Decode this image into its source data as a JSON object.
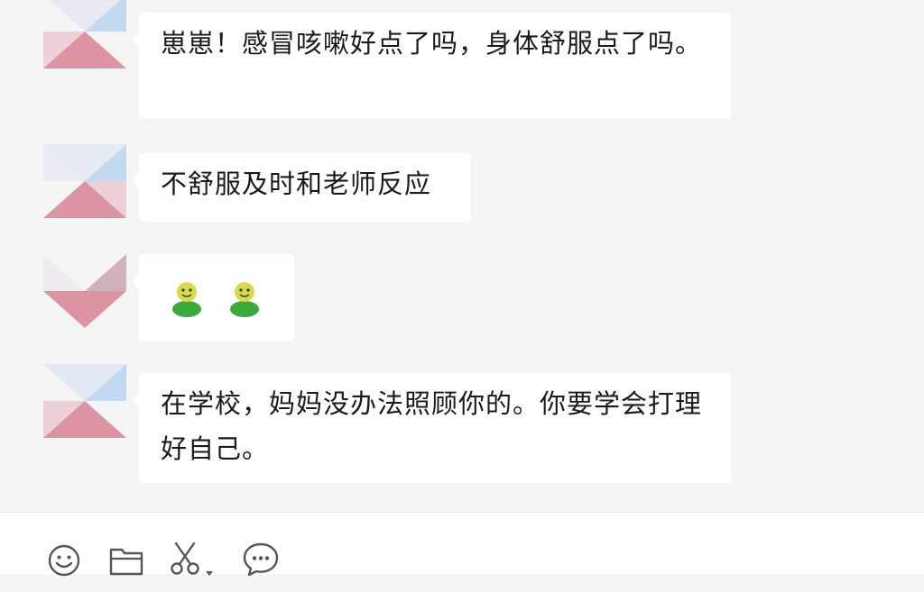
{
  "messages": [
    {
      "text": "崽崽！感冒咳嗽好点了吗，身体舒服点了吗。",
      "type": "text"
    },
    {
      "text": "不舒服及时和老师反应",
      "type": "text"
    },
    {
      "type": "emoji",
      "emojis": [
        "smiley-person-emoji",
        "smiley-person-emoji"
      ]
    },
    {
      "text": "在学校，妈妈没办法照顾你的。你要学会打理好自己。",
      "type": "text"
    }
  ],
  "toolbar": {
    "icons": [
      "emoji-icon",
      "folder-icon",
      "scissors-icon",
      "chevron-down-icon",
      "chat-bubble-icon"
    ]
  },
  "colors": {
    "background": "#f5f5f5",
    "bubble": "#ffffff",
    "avatar_blue": "#b8d4f0",
    "avatar_pink": "#d98a9a",
    "emoji_yellow": "#d4d44a",
    "emoji_green": "#3aaa3a"
  }
}
